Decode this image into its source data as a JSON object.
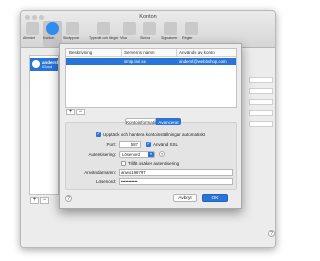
{
  "window": {
    "title": "Konton"
  },
  "toolbar": {
    "items": [
      {
        "label": "Allmänt"
      },
      {
        "label": "Konton"
      },
      {
        "label": "Skräppost"
      },
      {
        "label": "Typsnitt och färger"
      },
      {
        "label": "Visa"
      },
      {
        "label": "Skriva"
      },
      {
        "label": "Signaturer"
      },
      {
        "label": "Regler"
      }
    ]
  },
  "sidebar": {
    "account_title": "andersf",
    "account_sub": "iCloud",
    "add_label": "+",
    "remove_label": "−"
  },
  "help_label": "?",
  "sheet": {
    "table": {
      "headers": [
        "Beskrivning",
        "Serverns namn",
        "Används av konto"
      ],
      "rows": [
        {
          "description": "",
          "server": "smtp.lari.se",
          "used_by": "andersf@webbshop.com"
        }
      ]
    },
    "add_label": "+",
    "remove_label": "−",
    "tabs": [
      "Kontoinformation",
      "Avancerat"
    ],
    "selected_tab": "Avancerat",
    "auto_detect_label": "Upptäck och hantera kontoinställningar automatiskt",
    "port_label": "Port:",
    "port_value": "587",
    "ssl_label": "Använd SSL",
    "auth_label": "Autentisering:",
    "auth_value": "Lösenord",
    "insecure_label": "Tillåt osäker autentisering",
    "username_label": "Användarnamn:",
    "username_value": "anwo198797",
    "password_label": "Lösenord:",
    "password_value": "•••••••••••",
    "cancel_label": "Avbryt",
    "ok_label": "OK",
    "help_label": "?"
  }
}
